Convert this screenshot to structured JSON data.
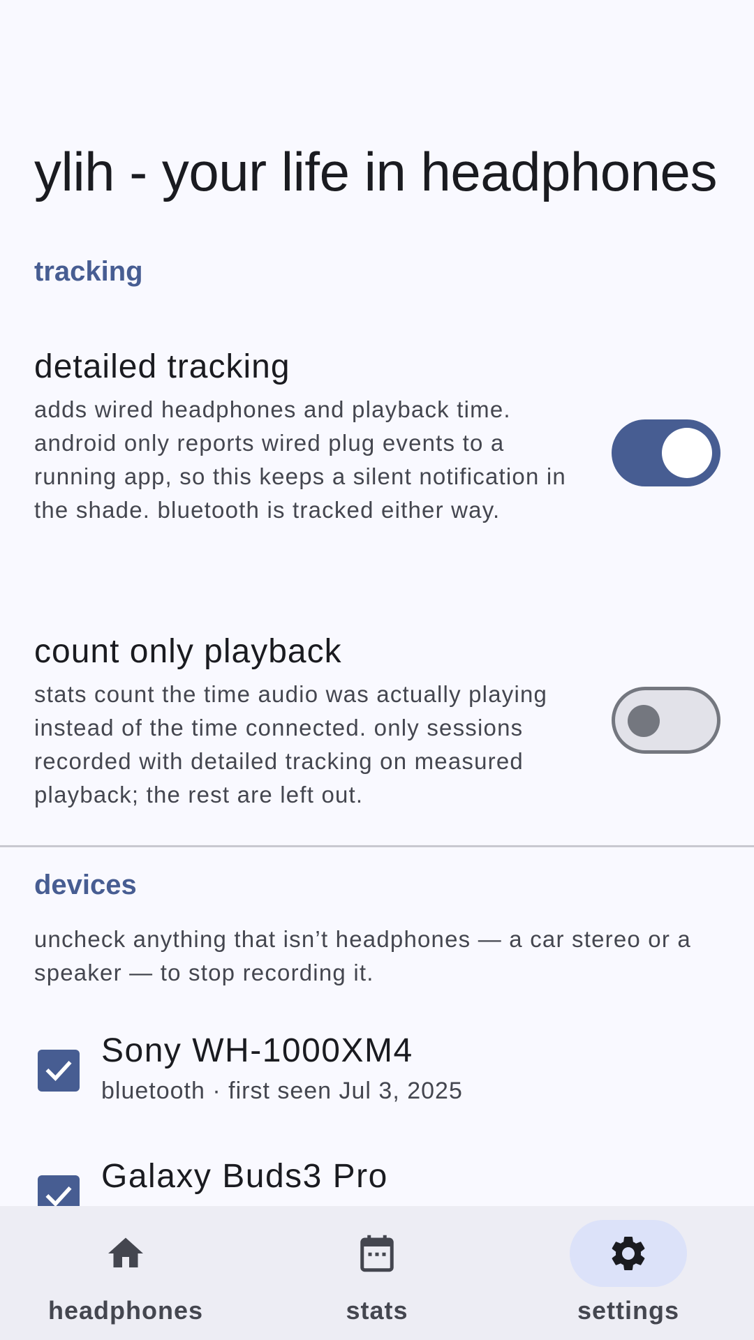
{
  "app": {
    "title": "ylih - your life in headphones"
  },
  "tracking": {
    "header": "tracking",
    "settings": [
      {
        "title": "detailed tracking",
        "description": "adds wired headphones and playback time. android only reports wired plug events to a running app, so this keeps a silent notification in the shade. bluetooth is tracked either way.",
        "enabled": true
      },
      {
        "title": "count only playback",
        "description": "stats count the time audio was actually playing instead of the time connected. only sessions recorded with detailed tracking on measured playback; the rest are left out.",
        "enabled": false
      }
    ]
  },
  "devices": {
    "header": "devices",
    "help": "uncheck anything that isn’t headphones — a car stereo or a speaker — to stop recording it.",
    "items": [
      {
        "name": "Sony WH-1000XM4",
        "meta": "bluetooth · first seen Jul 3, 2025",
        "checked": true
      },
      {
        "name": "Galaxy Buds3 Pro",
        "meta": "",
        "checked": true
      }
    ]
  },
  "nav": {
    "items": [
      {
        "label": "headphones",
        "icon": "home-icon",
        "active": false
      },
      {
        "label": "stats",
        "icon": "calendar-icon",
        "active": false
      },
      {
        "label": "settings",
        "icon": "gear-icon",
        "active": true
      }
    ]
  },
  "colors": {
    "accent": "#475d92",
    "background": "#f9f9ff",
    "nav_background": "#ededf4",
    "nav_active_pill": "#dce2f9"
  }
}
